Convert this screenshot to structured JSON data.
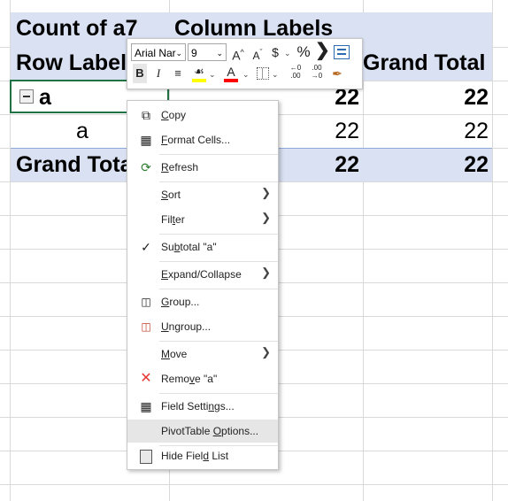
{
  "pivot": {
    "header_row1": {
      "count_label": "Count of a7",
      "column_labels": "Column Labels"
    },
    "header_row2": {
      "row_labels": "Row Labels",
      "grand_total": "Grand Total"
    },
    "row_a": {
      "label": "a",
      "value": "22",
      "total": "22"
    },
    "row_a_sub": {
      "label": "a",
      "value": "22",
      "total": "22"
    },
    "grand_total_row": {
      "label": "Grand Total",
      "value": "22",
      "total": "22"
    }
  },
  "mini_toolbar": {
    "font_name": "Arial Nar",
    "font_size": "9",
    "grow_font": "A^",
    "shrink_font": "Aˇ",
    "currency": "$",
    "percent": "%",
    "comma": "’",
    "bold": "B",
    "italic": "I",
    "highlight_color": "#ffff00",
    "font_color": "#ff0000"
  },
  "context_menu": {
    "items": [
      {
        "label_pre": "",
        "label_u": "C",
        "label_post": "opy",
        "icon": "copy-icon"
      },
      {
        "label_pre": "",
        "label_u": "F",
        "label_post": "ormat Cells...",
        "icon": "format-cells-icon"
      },
      {
        "label_pre": "",
        "label_u": "R",
        "label_post": "efresh",
        "icon": "refresh-icon"
      },
      {
        "label_pre": "",
        "label_u": "S",
        "label_post": "ort",
        "icon": ""
      },
      {
        "label_pre": "Fil",
        "label_u": "t",
        "label_post": "er",
        "icon": ""
      },
      {
        "label_pre": "Su",
        "label_u": "b",
        "label_post": "total \"a\"",
        "icon": "checkmark-icon",
        "check": "✓"
      },
      {
        "label_pre": "",
        "label_u": "E",
        "label_post": "xpand/Collapse",
        "icon": ""
      },
      {
        "label_pre": "",
        "label_u": "G",
        "label_post": "roup...",
        "icon": "group-icon"
      },
      {
        "label_pre": "",
        "label_u": "U",
        "label_post": "ngroup...",
        "icon": "ungroup-icon"
      },
      {
        "label_pre": "",
        "label_u": "M",
        "label_post": "ove",
        "icon": ""
      },
      {
        "label_pre": "Remo",
        "label_u": "v",
        "label_post": "e \"a\"",
        "icon": "remove-icon"
      },
      {
        "label_pre": "Field Setti",
        "label_u": "n",
        "label_post": "gs...",
        "icon": "field-settings-icon"
      },
      {
        "label_pre": "PivotTable ",
        "label_u": "O",
        "label_post": "ptions...",
        "icon": ""
      },
      {
        "label_pre": "Hide Fiel",
        "label_u": "d",
        "label_post": " List",
        "icon": "hide-field-list-icon"
      }
    ]
  }
}
